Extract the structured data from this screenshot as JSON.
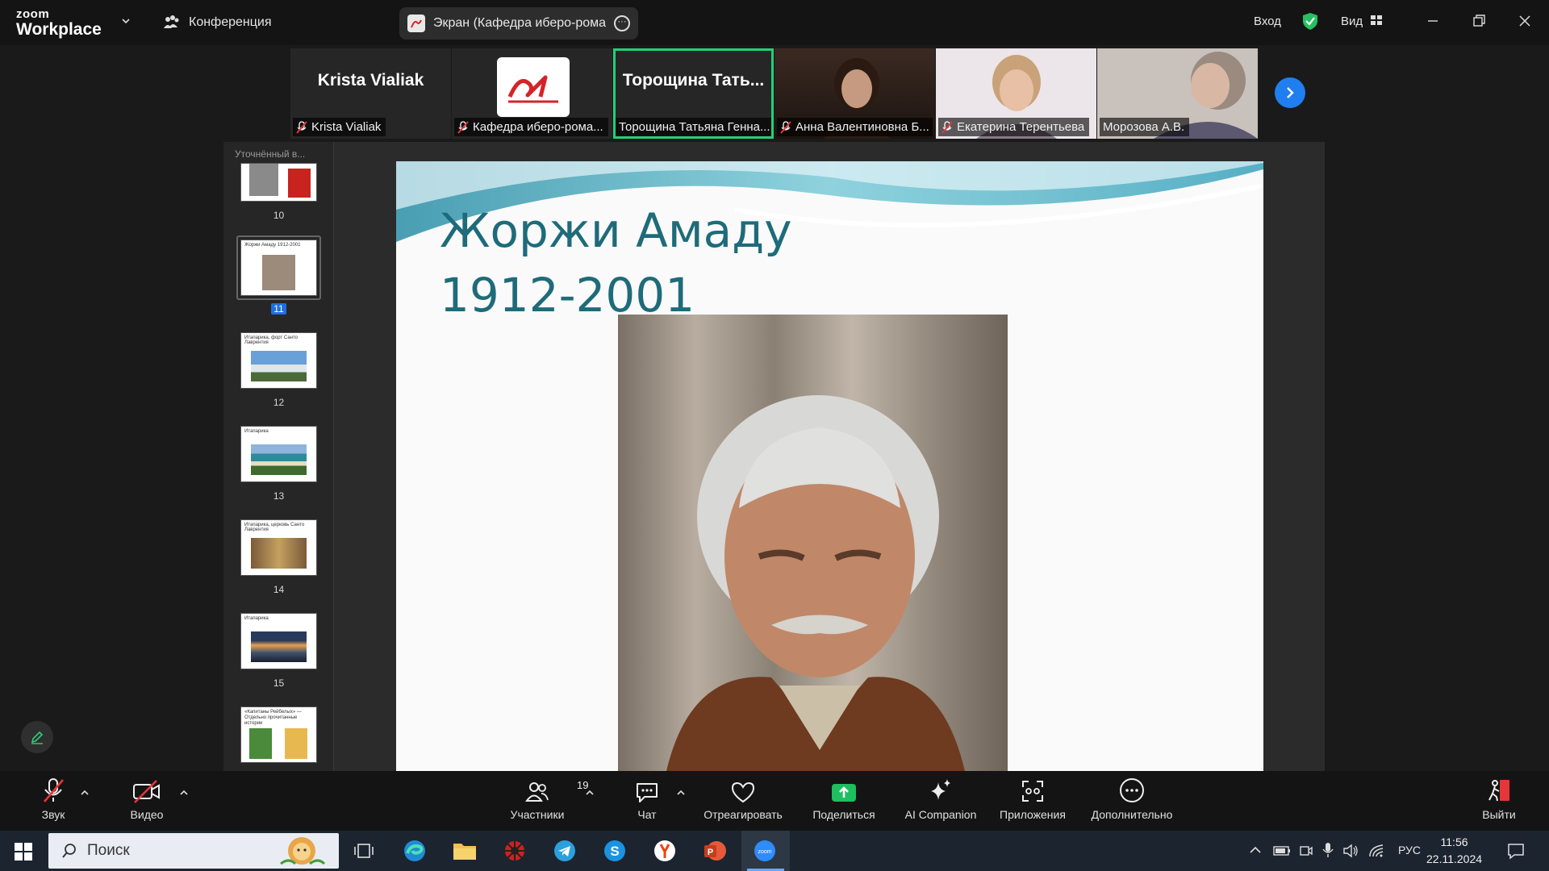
{
  "app": {
    "brand_top": "zoom",
    "brand_bottom": "Workplace"
  },
  "topbar": {
    "conference_label": "Конференция",
    "share_title": "Экран (Кафедра иберо-романс",
    "signin_label": "Вход",
    "view_label": "Вид"
  },
  "participants": [
    {
      "display": "Krista Vialiak",
      "name": "Krista Vialiak",
      "muted": true,
      "type": "name"
    },
    {
      "display": "",
      "name": "Кафедра иберо-рома...",
      "muted": true,
      "type": "logo"
    },
    {
      "display": "Торощина Тать...",
      "name": "Торощина Татьяна Генна...",
      "muted": false,
      "type": "name",
      "active": true
    },
    {
      "display": "",
      "name": "Анна Валентиновна Б...",
      "muted": true,
      "type": "video"
    },
    {
      "display": "",
      "name": "Екатерина Терентьева",
      "muted": true,
      "type": "video"
    },
    {
      "display": "",
      "name": "Морозова А.В.",
      "muted": false,
      "type": "video"
    }
  ],
  "sidebar": {
    "title": "Уточнённый в...",
    "slides": [
      {
        "num": "10",
        "title": ""
      },
      {
        "num": "11",
        "title": "Жоржи Амаду 1912-2001",
        "selected": true
      },
      {
        "num": "12",
        "title": "Итапарика, форт Санто Лаврентия"
      },
      {
        "num": "13",
        "title": "Итапарика"
      },
      {
        "num": "14",
        "title": "Итапарика, церковь Санто Лаврентия"
      },
      {
        "num": "15",
        "title": "Итапарика"
      },
      {
        "num": "",
        "title": "«Капитаны Рейбелых» — Отдельно прочитанные истории"
      }
    ]
  },
  "slide": {
    "title_line1": "Жоржи Амаду",
    "title_line2": "1912-2001"
  },
  "toolbar": {
    "audio_label": "Звук",
    "video_label": "Видео",
    "participants_label": "Участники",
    "participants_count": "19",
    "chat_label": "Чат",
    "react_label": "Отреагировать",
    "share_label": "Поделиться",
    "ai_label": "AI Companion",
    "apps_label": "Приложения",
    "more_label": "Дополнительно",
    "leave_label": "Выйти"
  },
  "taskbar": {
    "search_placeholder": "Поиск",
    "lang": "РУС",
    "time": "11:56",
    "date": "22.11.2024"
  },
  "colors": {
    "accent_green": "#24d07a",
    "zoom_blue": "#1f7ff0",
    "share_green": "#1dbf5e",
    "slide_title": "#1e6b7a"
  }
}
